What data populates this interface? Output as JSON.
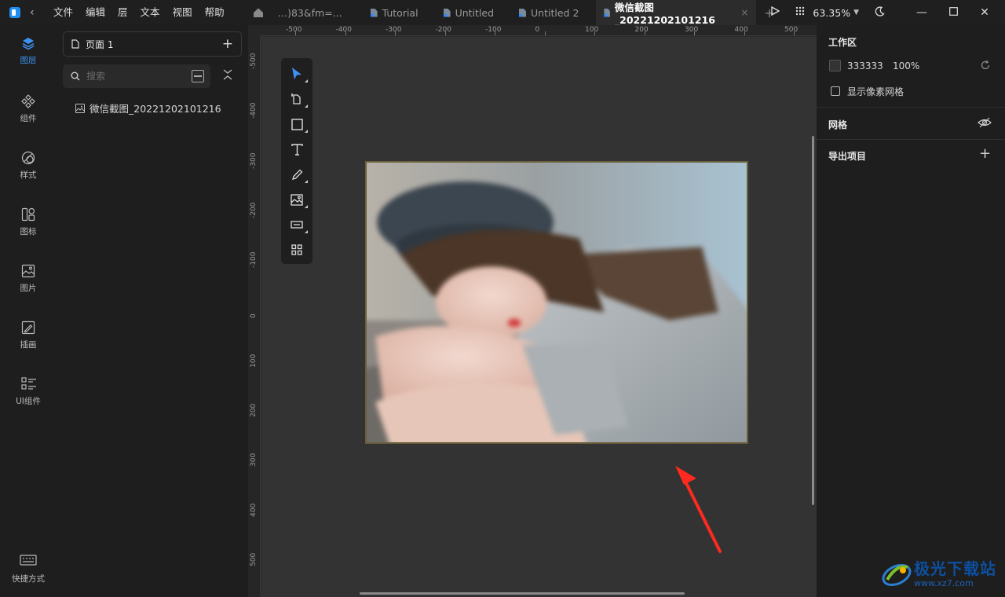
{
  "titlebar": {
    "menu": [
      "文件",
      "编辑",
      "层",
      "文本",
      "视图",
      "帮助"
    ],
    "tabs": [
      {
        "label": "…)83&fm=...",
        "active": false,
        "has_icon": false
      },
      {
        "label": "Tutorial",
        "active": false,
        "has_icon": true
      },
      {
        "label": "Untitled",
        "active": false,
        "has_icon": true
      },
      {
        "label": "Untitled 2",
        "active": false,
        "has_icon": true
      },
      {
        "label": "微信截图_20221202101216",
        "active": true,
        "has_icon": true
      }
    ],
    "close_glyph": "×",
    "add_glyph": "+",
    "zoom": "63.35%",
    "icons": [
      "play-icon",
      "grid-dots-icon",
      "moon-icon",
      "minimize-icon",
      "maximize-icon",
      "close-icon"
    ]
  },
  "rail": [
    {
      "label": "图层",
      "icon": "layers-icon",
      "active": true
    },
    {
      "label": "组件",
      "icon": "component-icon",
      "active": false
    },
    {
      "label": "样式",
      "icon": "style-icon",
      "active": false
    },
    {
      "label": "图标",
      "icon": "icons-icon",
      "active": false
    },
    {
      "label": "图片",
      "icon": "picture-icon",
      "active": false
    },
    {
      "label": "插画",
      "icon": "illustration-icon",
      "active": false
    },
    {
      "label": "UI组件",
      "icon": "ui-kit-icon",
      "active": false
    }
  ],
  "shortcuts_label": "快捷方式",
  "layers_panel": {
    "page_label": "页面 1",
    "search_placeholder": "搜索",
    "layer_name": "微信截图_20221202101216"
  },
  "ruler": {
    "top": [
      "-500",
      "-400",
      "-300",
      "-200",
      "-100",
      "0",
      "100",
      "200",
      "300",
      "400",
      "500"
    ],
    "left": [
      "-500",
      "-400",
      "-300",
      "-200",
      "-100",
      "0",
      "100",
      "200",
      "300",
      "400",
      "500"
    ]
  },
  "tools": [
    "select-tool",
    "page-tool",
    "rectangle-tool",
    "text-tool",
    "pen-tool",
    "image-tool",
    "component-tool",
    "grid-tool"
  ],
  "right_panel": {
    "workspace_title": "工作区",
    "bg_color": "333333",
    "bg_opacity": "100%",
    "pixel_grid_label": "显示像素网格",
    "grid_title": "网格",
    "export_title": "导出项目"
  },
  "watermark": {
    "title": "极光下载站",
    "url": "www.xz7.com"
  },
  "colors": {
    "accent": "#3c93f5",
    "canvas": "#333333",
    "arrow": "#ff2a1f"
  }
}
